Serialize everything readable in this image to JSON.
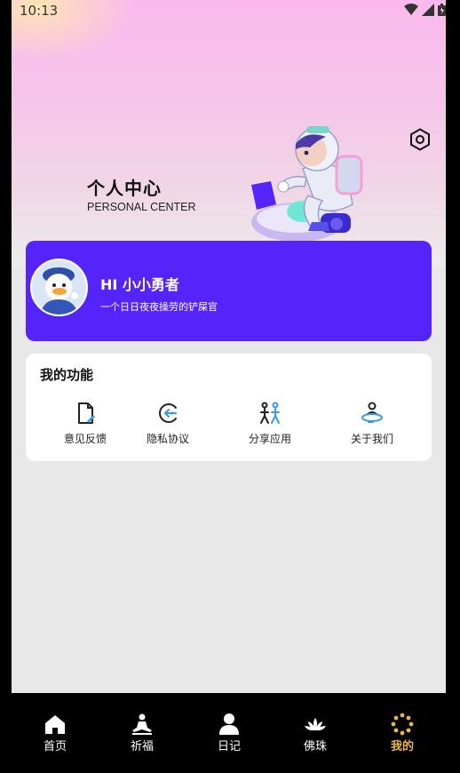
{
  "status": {
    "time": "10:13"
  },
  "header": {
    "title": "个人中心",
    "subtitle": "PERSONAL CENTER"
  },
  "profile": {
    "name": "HI 小小勇者",
    "bio": "一个日日夜夜操劳的铲屎官"
  },
  "functions": {
    "title": "我的功能",
    "items": [
      {
        "label": "意见反馈",
        "icon": "feedback-icon"
      },
      {
        "label": "隐私协议",
        "icon": "privacy-icon"
      },
      {
        "label": "分享应用",
        "icon": "share-icon"
      },
      {
        "label": "关于我们",
        "icon": "about-icon"
      }
    ]
  },
  "tabs": [
    {
      "label": "首页",
      "icon": "home-icon"
    },
    {
      "label": "祈福",
      "icon": "meditation-icon"
    },
    {
      "label": "日记",
      "icon": "person-icon"
    },
    {
      "label": "佛珠",
      "icon": "lotus-icon"
    },
    {
      "label": "我的",
      "icon": "beads-icon",
      "active": true
    }
  ],
  "colors": {
    "accent": "#5424fb",
    "active_tab": "#e8b64b",
    "icon_blue": "#3a9be9"
  }
}
